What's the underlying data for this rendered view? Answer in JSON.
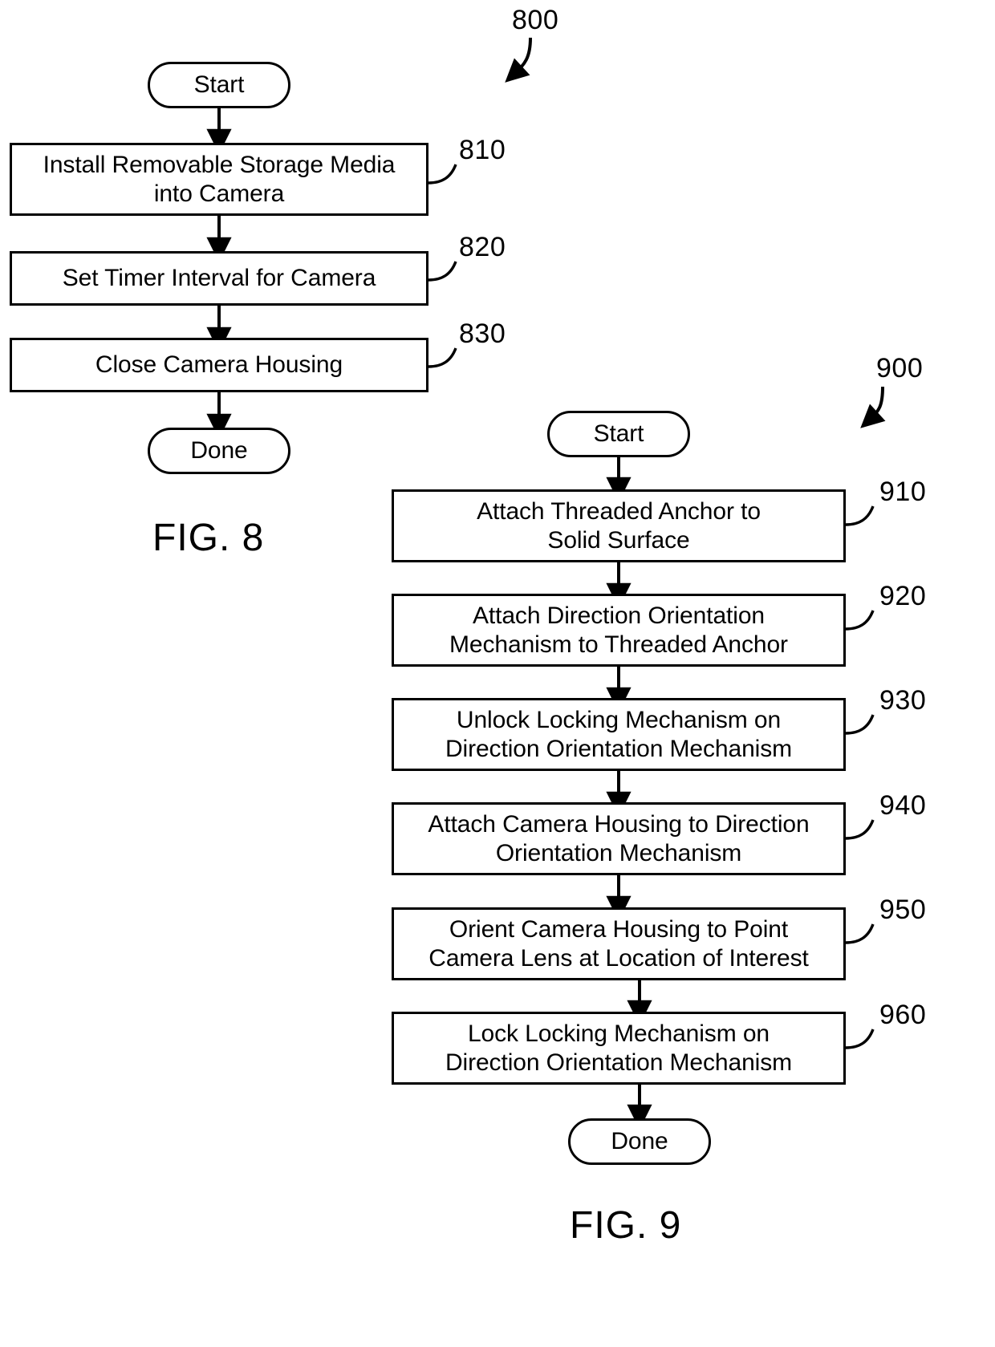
{
  "document": {
    "type": "patent-flowchart-sheet",
    "figures": [
      {
        "id": "fig8",
        "caption": "FIG. 8",
        "ref_label": "800",
        "nodes": [
          {
            "ref": "",
            "kind": "terminal",
            "text": "Start"
          },
          {
            "ref": "810",
            "kind": "process",
            "text": "Install Removable Storage Media\ninto Camera"
          },
          {
            "ref": "820",
            "kind": "process",
            "text": "Set Timer Interval for Camera"
          },
          {
            "ref": "830",
            "kind": "process",
            "text": "Close Camera Housing"
          },
          {
            "ref": "",
            "kind": "terminal",
            "text": "Done"
          }
        ]
      },
      {
        "id": "fig9",
        "caption": "FIG. 9",
        "ref_label": "900",
        "nodes": [
          {
            "ref": "",
            "kind": "terminal",
            "text": "Start"
          },
          {
            "ref": "910",
            "kind": "process",
            "text": "Attach Threaded Anchor to\nSolid Surface"
          },
          {
            "ref": "920",
            "kind": "process",
            "text": "Attach Direction Orientation\nMechanism to Threaded Anchor"
          },
          {
            "ref": "930",
            "kind": "process",
            "text": "Unlock Locking Mechanism on\nDirection Orientation Mechanism"
          },
          {
            "ref": "940",
            "kind": "process",
            "text": "Attach Camera Housing to Direction\nOrientation Mechanism"
          },
          {
            "ref": "950",
            "kind": "process",
            "text": "Orient Camera Housing to Point\nCamera Lens at Location of Interest"
          },
          {
            "ref": "960",
            "kind": "process",
            "text": "Lock Locking Mechanism on\nDirection Orientation Mechanism"
          },
          {
            "ref": "",
            "kind": "terminal",
            "text": "Done"
          }
        ]
      }
    ]
  },
  "colors": {
    "ink": "#000000",
    "paper": "#ffffff"
  }
}
